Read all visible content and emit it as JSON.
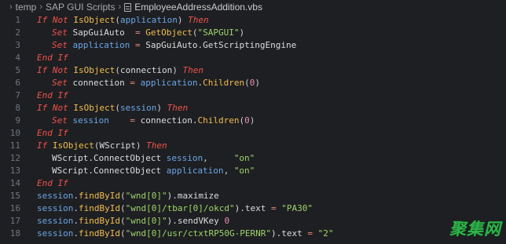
{
  "breadcrumb": {
    "items": [
      "temp",
      "SAP GUI Scripts"
    ],
    "file": "EmployeeAddressAddition.vbs",
    "file_icon": "vbs-file-icon"
  },
  "code_lines": [
    {
      "n": "1",
      "indent": 0,
      "tokens": [
        {
          "t": "If ",
          "c": "kw"
        },
        {
          "t": "Not ",
          "c": "kw"
        },
        {
          "t": "IsObject",
          "c": "fn"
        },
        {
          "t": "(",
          "c": "p"
        },
        {
          "t": "application",
          "c": "var"
        },
        {
          "t": ") ",
          "c": "p"
        },
        {
          "t": "Then",
          "c": "kw"
        }
      ]
    },
    {
      "n": "2",
      "indent": 1,
      "tokens": [
        {
          "t": "Set ",
          "c": "kw"
        },
        {
          "t": "SapGuiAuto  ",
          "c": "id"
        },
        {
          "t": "= ",
          "c": "op"
        },
        {
          "t": "GetObject",
          "c": "fn"
        },
        {
          "t": "(",
          "c": "p"
        },
        {
          "t": "\"SAPGUI\"",
          "c": "str"
        },
        {
          "t": ")",
          "c": "p"
        }
      ]
    },
    {
      "n": "3",
      "indent": 1,
      "tokens": [
        {
          "t": "Set ",
          "c": "kw"
        },
        {
          "t": "application ",
          "c": "var"
        },
        {
          "t": "= ",
          "c": "op"
        },
        {
          "t": "SapGuiAuto.GetScriptingEngine",
          "c": "id"
        }
      ]
    },
    {
      "n": "4",
      "indent": 0,
      "tokens": [
        {
          "t": "End If",
          "c": "kw"
        }
      ]
    },
    {
      "n": "5",
      "indent": 0,
      "tokens": [
        {
          "t": "If ",
          "c": "kw"
        },
        {
          "t": "Not ",
          "c": "kw"
        },
        {
          "t": "IsObject",
          "c": "fn"
        },
        {
          "t": "(",
          "c": "p"
        },
        {
          "t": "connection",
          "c": "id"
        },
        {
          "t": ") ",
          "c": "p"
        },
        {
          "t": "Then",
          "c": "kw"
        }
      ]
    },
    {
      "n": "6",
      "indent": 1,
      "tokens": [
        {
          "t": "Set ",
          "c": "kw"
        },
        {
          "t": "connection ",
          "c": "id"
        },
        {
          "t": "= ",
          "c": "op"
        },
        {
          "t": "application",
          "c": "var"
        },
        {
          "t": ".",
          "c": "p"
        },
        {
          "t": "Children",
          "c": "fn"
        },
        {
          "t": "(",
          "c": "p"
        },
        {
          "t": "0",
          "c": "num"
        },
        {
          "t": ")",
          "c": "p"
        }
      ]
    },
    {
      "n": "7",
      "indent": 0,
      "tokens": [
        {
          "t": "End If",
          "c": "kw"
        }
      ]
    },
    {
      "n": "8",
      "indent": 0,
      "tokens": [
        {
          "t": "If ",
          "c": "kw"
        },
        {
          "t": "Not ",
          "c": "kw"
        },
        {
          "t": "IsObject",
          "c": "fn"
        },
        {
          "t": "(",
          "c": "p"
        },
        {
          "t": "session",
          "c": "var"
        },
        {
          "t": ") ",
          "c": "p"
        },
        {
          "t": "Then",
          "c": "kw"
        }
      ]
    },
    {
      "n": "9",
      "indent": 1,
      "tokens": [
        {
          "t": "Set ",
          "c": "kw"
        },
        {
          "t": "session    ",
          "c": "var"
        },
        {
          "t": "= ",
          "c": "op"
        },
        {
          "t": "connection.",
          "c": "id"
        },
        {
          "t": "Children",
          "c": "fn"
        },
        {
          "t": "(",
          "c": "p"
        },
        {
          "t": "0",
          "c": "num"
        },
        {
          "t": ")",
          "c": "p"
        }
      ]
    },
    {
      "n": "10",
      "indent": 0,
      "tokens": [
        {
          "t": "End If",
          "c": "kw"
        }
      ]
    },
    {
      "n": "11",
      "indent": 0,
      "tokens": [
        {
          "t": "If ",
          "c": "kw"
        },
        {
          "t": "IsObject",
          "c": "fn"
        },
        {
          "t": "(",
          "c": "p"
        },
        {
          "t": "WScript",
          "c": "id"
        },
        {
          "t": ") ",
          "c": "p"
        },
        {
          "t": "Then",
          "c": "kw"
        }
      ]
    },
    {
      "n": "12",
      "indent": 1,
      "tokens": [
        {
          "t": "WScript.ConnectObject ",
          "c": "id"
        },
        {
          "t": "session",
          "c": "var"
        },
        {
          "t": ",     ",
          "c": "p"
        },
        {
          "t": "\"on\"",
          "c": "str"
        }
      ]
    },
    {
      "n": "13",
      "indent": 1,
      "tokens": [
        {
          "t": "WScript.ConnectObject ",
          "c": "id"
        },
        {
          "t": "application",
          "c": "var"
        },
        {
          "t": ", ",
          "c": "p"
        },
        {
          "t": "\"on\"",
          "c": "str"
        }
      ]
    },
    {
      "n": "14",
      "indent": 0,
      "tokens": [
        {
          "t": "End If",
          "c": "kw"
        }
      ]
    },
    {
      "n": "15",
      "indent": 0,
      "tokens": [
        {
          "t": "session",
          "c": "var"
        },
        {
          "t": ".",
          "c": "p"
        },
        {
          "t": "findById",
          "c": "fn"
        },
        {
          "t": "(",
          "c": "p"
        },
        {
          "t": "\"wnd[0]\"",
          "c": "str"
        },
        {
          "t": ").maximize",
          "c": "id"
        }
      ]
    },
    {
      "n": "16",
      "indent": 0,
      "tokens": [
        {
          "t": "session",
          "c": "var"
        },
        {
          "t": ".",
          "c": "p"
        },
        {
          "t": "findById",
          "c": "fn"
        },
        {
          "t": "(",
          "c": "p"
        },
        {
          "t": "\"wnd[0]/tbar[0]/okcd\"",
          "c": "str"
        },
        {
          "t": ").text ",
          "c": "id"
        },
        {
          "t": "= ",
          "c": "op"
        },
        {
          "t": "\"PA30\"",
          "c": "str"
        }
      ]
    },
    {
      "n": "17",
      "indent": 0,
      "tokens": [
        {
          "t": "session",
          "c": "var"
        },
        {
          "t": ".",
          "c": "p"
        },
        {
          "t": "findById",
          "c": "fn"
        },
        {
          "t": "(",
          "c": "p"
        },
        {
          "t": "\"wnd[0]\"",
          "c": "str"
        },
        {
          "t": ").sendVKey ",
          "c": "id"
        },
        {
          "t": "0",
          "c": "num"
        }
      ]
    },
    {
      "n": "18",
      "indent": 0,
      "tokens": [
        {
          "t": "session",
          "c": "var"
        },
        {
          "t": ".",
          "c": "p"
        },
        {
          "t": "findById",
          "c": "fn"
        },
        {
          "t": "(",
          "c": "p"
        },
        {
          "t": "\"wnd[0]/usr/ctxtRP50G-PERNR\"",
          "c": "str"
        },
        {
          "t": ").text ",
          "c": "id"
        },
        {
          "t": "= ",
          "c": "op"
        },
        {
          "t": "\"2\"",
          "c": "str"
        }
      ]
    }
  ],
  "watermark": "聚集网"
}
